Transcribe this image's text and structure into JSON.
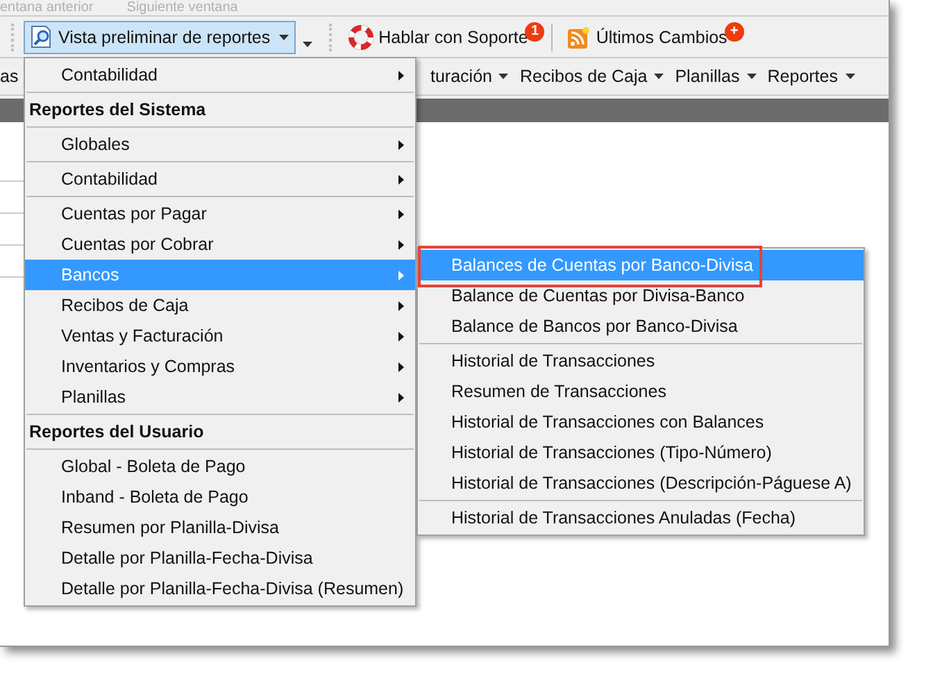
{
  "top_strip": {
    "items": [
      {
        "label": "entana anterior",
        "disabled": true
      },
      {
        "label": "Siguiente ventana",
        "disabled": true
      }
    ]
  },
  "toolbar": {
    "report_button": {
      "label": "Vista preliminar de reportes",
      "pressed": true
    },
    "support_button": {
      "label": "Hablar con Soporte",
      "badge": "1"
    },
    "changes_button": {
      "label": "Últimos Cambios",
      "badge": "+"
    }
  },
  "menubar": {
    "items": [
      {
        "label": "as"
      },
      {
        "label": "turación"
      },
      {
        "label": "Recibos de Caja"
      },
      {
        "label": "Planillas"
      },
      {
        "label": "Reportes"
      }
    ]
  },
  "report_menu": {
    "items": [
      {
        "kind": "item",
        "label": "Contabilidad",
        "submenu": true,
        "selected": false
      },
      {
        "kind": "separator"
      },
      {
        "kind": "header",
        "label": "Reportes del Sistema"
      },
      {
        "kind": "separator"
      },
      {
        "kind": "item",
        "label": "Globales",
        "submenu": true,
        "selected": false
      },
      {
        "kind": "separator"
      },
      {
        "kind": "item",
        "label": "Contabilidad",
        "submenu": true,
        "selected": false
      },
      {
        "kind": "separator"
      },
      {
        "kind": "item",
        "label": "Cuentas por Pagar",
        "submenu": true,
        "selected": false
      },
      {
        "kind": "item",
        "label": "Cuentas por Cobrar",
        "submenu": true,
        "selected": false
      },
      {
        "kind": "item",
        "label": "Bancos",
        "submenu": true,
        "selected": true
      },
      {
        "kind": "item",
        "label": "Recibos de Caja",
        "submenu": true,
        "selected": false
      },
      {
        "kind": "item",
        "label": "Ventas y Facturación",
        "submenu": true,
        "selected": false
      },
      {
        "kind": "item",
        "label": "Inventarios y Compras",
        "submenu": true,
        "selected": false
      },
      {
        "kind": "item",
        "label": "Planillas",
        "submenu": true,
        "selected": false
      },
      {
        "kind": "separator"
      },
      {
        "kind": "header",
        "label": "Reportes del Usuario"
      },
      {
        "kind": "separator"
      },
      {
        "kind": "item",
        "label": "Global - Boleta de Pago",
        "submenu": false,
        "selected": false
      },
      {
        "kind": "item",
        "label": "Inband - Boleta de Pago",
        "submenu": false,
        "selected": false
      },
      {
        "kind": "item",
        "label": "Resumen por Planilla-Divisa",
        "submenu": false,
        "selected": false
      },
      {
        "kind": "item",
        "label": "Detalle por Planilla-Fecha-Divisa",
        "submenu": false,
        "selected": false
      },
      {
        "kind": "item",
        "label": "Detalle por Planilla-Fecha-Divisa (Resumen)",
        "submenu": false,
        "selected": false
      }
    ]
  },
  "bancos_submenu": {
    "items": [
      {
        "kind": "item",
        "label": "Balances de Cuentas por Banco-Divisa",
        "selected": true,
        "highlighted": true
      },
      {
        "kind": "item",
        "label": "Balance de Cuentas por Divisa-Banco",
        "selected": false,
        "highlighted": false
      },
      {
        "kind": "item",
        "label": "Balance de Bancos por Banco-Divisa",
        "selected": false,
        "highlighted": false
      },
      {
        "kind": "separator"
      },
      {
        "kind": "item",
        "label": "Historial de Transacciones",
        "selected": false,
        "highlighted": false
      },
      {
        "kind": "item",
        "label": "Resumen de Transacciones",
        "selected": false,
        "highlighted": false
      },
      {
        "kind": "item",
        "label": "Historial de Transacciones con Balances",
        "selected": false,
        "highlighted": false
      },
      {
        "kind": "item",
        "label": "Historial de Transacciones (Tipo-Número)",
        "selected": false,
        "highlighted": false
      },
      {
        "kind": "item",
        "label": "Historial de Transacciones (Descripción-Páguese A)",
        "selected": false,
        "highlighted": false
      },
      {
        "kind": "separator"
      },
      {
        "kind": "item",
        "label": "Historial de Transacciones Anuladas (Fecha)",
        "selected": false,
        "highlighted": false
      }
    ]
  }
}
